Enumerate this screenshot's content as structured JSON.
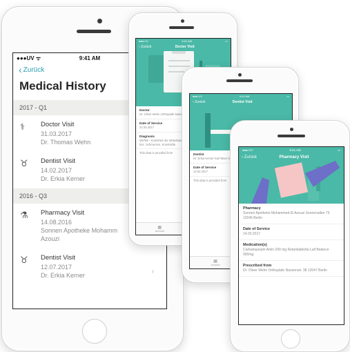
{
  "colors": {
    "teal": "#4ab9a7",
    "link": "#29a0b1"
  },
  "phone1": {
    "carrier": "UV",
    "time": "9:41 AM",
    "back_label": "Zurück",
    "title": "Medical History",
    "sections": [
      {
        "label": "2017 - Q1",
        "entries": [
          {
            "icon": "stethoscope-icon",
            "glyph": "⚕",
            "title": "Doctor Visit",
            "date": "31.03.2017",
            "detail": "Dr. Thomas Wehn",
            "detail2": ""
          },
          {
            "icon": "tooth-icon",
            "glyph": "♉",
            "title": "Dentist Visit",
            "date": "14.02.2017",
            "detail": "Dr. Erkia Kerner",
            "detail2": ""
          }
        ]
      },
      {
        "label": "2016 - Q3",
        "entries": [
          {
            "icon": "pharmacy-icon",
            "glyph": "⚗",
            "title": "Pharmacy Visit",
            "date": "14.08.2016",
            "detail": "Sonnen Apotheke Mohamm",
            "detail2": "Azouzi"
          },
          {
            "icon": "tooth-icon",
            "glyph": "♉",
            "title": "Dentist Visit",
            "date": "12.07.2017",
            "detail": "Dr. Erkia Kerner",
            "detail2": ""
          }
        ]
      }
    ]
  },
  "phone2": {
    "time": "9:41 AM",
    "back_label": "Zurück",
    "title": "Doctor Visit",
    "fields": [
      {
        "label": "Doctor",
        "value": "Dr. Oliver Wehn Orthopäde Nansenstr. 38 12047 Berlin"
      },
      {
        "label": "Date of Service",
        "value": "31.03.2017"
      },
      {
        "label": "Diagnosis",
        "value": "M5786 - Krankheit der Wirbelsäule und der Rücken: Sonstige näher bez. Schmerzen, Knie/Hüfte"
      }
    ],
    "footnote": "This data is provided from",
    "tabs": [
      {
        "label": "Account"
      },
      {
        "label": "Wallet"
      }
    ]
  },
  "phone3": {
    "time": "9:41 AM",
    "back_label": "Zurück",
    "title": "Dentist Visit",
    "fields": [
      {
        "label": "Dentist",
        "value": "Dr. Erika Kerner Karl-Marx-Str. 29 Zahnarzt 12043 Berlin"
      },
      {
        "label": "Date of Service",
        "value": "14.02.2017"
      }
    ],
    "footnote": "This data is provided from",
    "tabs": [
      {
        "label": "Account"
      },
      {
        "label": "Wallet"
      }
    ]
  },
  "phone4": {
    "time": "9:41 AM",
    "back_label": "Zurück",
    "title": "Pharmacy Visit",
    "fields": [
      {
        "label": "Pharmacy",
        "value": "Sonnen Apotheke Mohammed El Azouzi Sonnenallee 75 12045 Berlin"
      },
      {
        "label": "Date of Service",
        "value": "14.02.2017"
      },
      {
        "label": "Medication(s)",
        "value": "Carbamazepin Amin 200 mg Retanbabletta Laif Balance 900mg"
      },
      {
        "label": "Prescribed from",
        "value": "Dr. Oliver Wehn Orthopäde Nansenstr. 38 12047 Berlin"
      }
    ]
  }
}
